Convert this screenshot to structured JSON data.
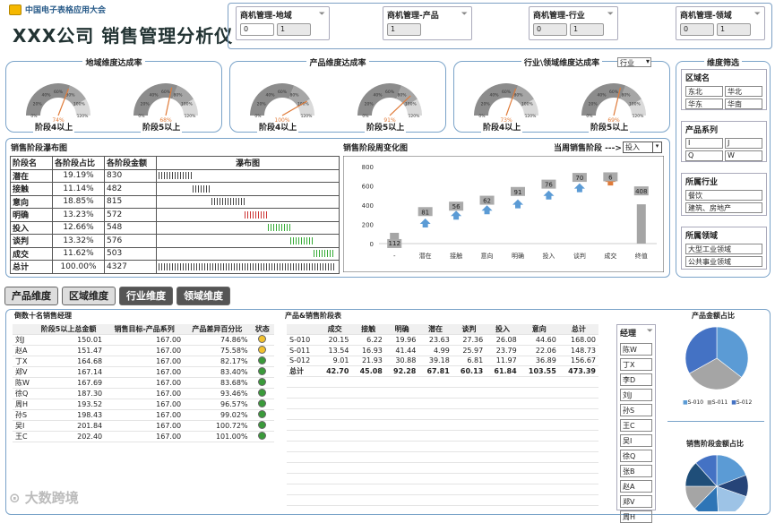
{
  "brand": "中国电子表格应用大会",
  "title": "XXX公司 销售管理分析仪",
  "top_slicers": [
    {
      "label": "商机管理-地域",
      "buttons": [
        "0",
        "1"
      ]
    },
    {
      "label": "商机管理-产品",
      "buttons": [
        "1"
      ]
    },
    {
      "label": "商机管理-行业",
      "buttons": [
        "0",
        "1"
      ]
    },
    {
      "label": "商机管理-领域",
      "buttons": [
        "0",
        "1"
      ]
    }
  ],
  "gauges": {
    "region": {
      "title": "地域维度达成率",
      "g1": {
        "val": "74%",
        "label": "阶段4以上",
        "value": 0.74
      },
      "g2": {
        "val": "68%",
        "label": "阶段5以上",
        "value": 0.68
      }
    },
    "product": {
      "title": "产品维度达成率",
      "g1": {
        "val": "100%",
        "label": "阶段4以上",
        "value": 1.0
      },
      "g2": {
        "val": "91%",
        "label": "阶段5以上",
        "value": 0.91
      }
    },
    "industry": {
      "title": "行业\\领域维度达成率",
      "select": "行业",
      "g1": {
        "val": "73%",
        "label": "阶段4以上",
        "value": 0.73
      },
      "g2": {
        "val": "69%",
        "label": "阶段5以上",
        "value": 0.69
      }
    },
    "ticks": [
      "0%",
      "20%",
      "40%",
      "60%",
      "80%",
      "100%",
      "120%"
    ]
  },
  "side": {
    "title": "维度筛选",
    "region": {
      "hd": "区域名",
      "items": [
        "东北",
        "华北",
        "华东",
        "华南"
      ]
    },
    "product": {
      "hd": "产品系列",
      "items": [
        "I",
        "J",
        "Q",
        "W"
      ]
    },
    "industry": {
      "hd": "所属行业",
      "items": [
        "餐饮",
        "建筑、房地产"
      ]
    },
    "domain": {
      "hd": "所属领域",
      "items": [
        "大型工业领域",
        "公共事业领域"
      ]
    }
  },
  "waterfall": {
    "title": "销售阶段瀑布图",
    "headers": [
      "阶段名",
      "各阶段占比",
      "各阶段金额",
      "瀑布图"
    ],
    "rows": [
      [
        "潜在",
        "19.19%",
        "830"
      ],
      [
        "接触",
        "11.14%",
        "482"
      ],
      [
        "意向",
        "18.85%",
        "815"
      ],
      [
        "明确",
        "13.23%",
        "572"
      ],
      [
        "投入",
        "12.66%",
        "548"
      ],
      [
        "谈判",
        "13.32%",
        "576"
      ],
      [
        "成交",
        "11.62%",
        "503"
      ],
      [
        "总计",
        "100.00%",
        "4327"
      ]
    ]
  },
  "weekly": {
    "title": "销售阶段周变化图",
    "current_label": "当周销售阶段 --->",
    "select": "投入",
    "y_ticks": [
      "800",
      "600",
      "400",
      "200",
      "0"
    ]
  },
  "chart_data": {
    "type": "bar",
    "title": "销售阶段周变化图",
    "categories": [
      "-",
      "潜在",
      "接触",
      "意向",
      "明确",
      "投入",
      "谈判",
      "成交",
      "终值"
    ],
    "values": [
      112,
      81,
      56,
      62,
      91,
      76,
      70,
      6,
      408
    ],
    "ylim": [
      0,
      800
    ]
  },
  "tabs": [
    "产品维度",
    "区域维度",
    "行业维度",
    "领域维度"
  ],
  "ranking": {
    "title": "倒数十名销售经理",
    "headers": [
      "",
      "阶段5以上总金额",
      "销售目标-产品系列",
      "产品差异百分比",
      "状态"
    ],
    "rows": [
      [
        "刘J",
        "150.01",
        "167.00",
        "74.86%",
        "#f2c12e"
      ],
      [
        "赵A",
        "151.47",
        "167.00",
        "75.58%",
        "#f2c12e"
      ],
      [
        "丁X",
        "164.68",
        "167.00",
        "82.17%",
        "#3a9a3a"
      ],
      [
        "郑V",
        "167.14",
        "167.00",
        "83.40%",
        "#3a9a3a"
      ],
      [
        "陈W",
        "167.69",
        "167.00",
        "83.68%",
        "#3a9a3a"
      ],
      [
        "徐Q",
        "187.30",
        "167.00",
        "93.46%",
        "#3a9a3a"
      ],
      [
        "周H",
        "193.52",
        "167.00",
        "96.57%",
        "#3a9a3a"
      ],
      [
        "孙S",
        "198.43",
        "167.00",
        "99.02%",
        "#3a9a3a"
      ],
      [
        "吴I",
        "201.84",
        "167.00",
        "100.72%",
        "#3a9a3a"
      ],
      [
        "王C",
        "202.40",
        "167.00",
        "101.00%",
        "#3a9a3a"
      ]
    ]
  },
  "stage_table": {
    "title": "产品&销售阶段表",
    "headers": [
      "",
      "成交",
      "接触",
      "明确",
      "潜在",
      "谈判",
      "投入",
      "意向",
      "总计"
    ],
    "rows": [
      [
        "S-010",
        "20.15",
        "6.22",
        "19.96",
        "23.63",
        "27.36",
        "26.08",
        "44.60",
        "168.00"
      ],
      [
        "S-011",
        "13.54",
        "16.93",
        "41.44",
        "4.99",
        "25.97",
        "23.79",
        "22.06",
        "148.73"
      ],
      [
        "S-012",
        "9.01",
        "21.93",
        "30.88",
        "39.18",
        "6.81",
        "11.97",
        "36.89",
        "156.67"
      ],
      [
        "总计",
        "42.70",
        "45.08",
        "92.28",
        "67.81",
        "60.13",
        "61.84",
        "103.55",
        "473.39"
      ]
    ]
  },
  "managers": {
    "hd": "经理",
    "items": [
      "陈W",
      "丁X",
      "李D",
      "刘J",
      "孙S",
      "王C",
      "吴I",
      "徐Q",
      "张B",
      "赵A",
      "郑V",
      "周H"
    ]
  },
  "pie1": {
    "title": "产品金额占比",
    "legend": [
      "S-010",
      "S-011",
      "S-012"
    ],
    "values": [
      168.0,
      148.73,
      156.67
    ],
    "colors": [
      "#5b9bd5",
      "#a5a5a5",
      "#4472c4"
    ]
  },
  "pie2": {
    "title": "销售阶段金额占比",
    "values": [
      830,
      482,
      815,
      572,
      548,
      576,
      503
    ],
    "colors": [
      "#5b9bd5",
      "#264478",
      "#9dc3e6",
      "#2e75b6",
      "#a5a5a5",
      "#1f4e79",
      "#4472c4"
    ]
  },
  "watermark": "大数跨境"
}
